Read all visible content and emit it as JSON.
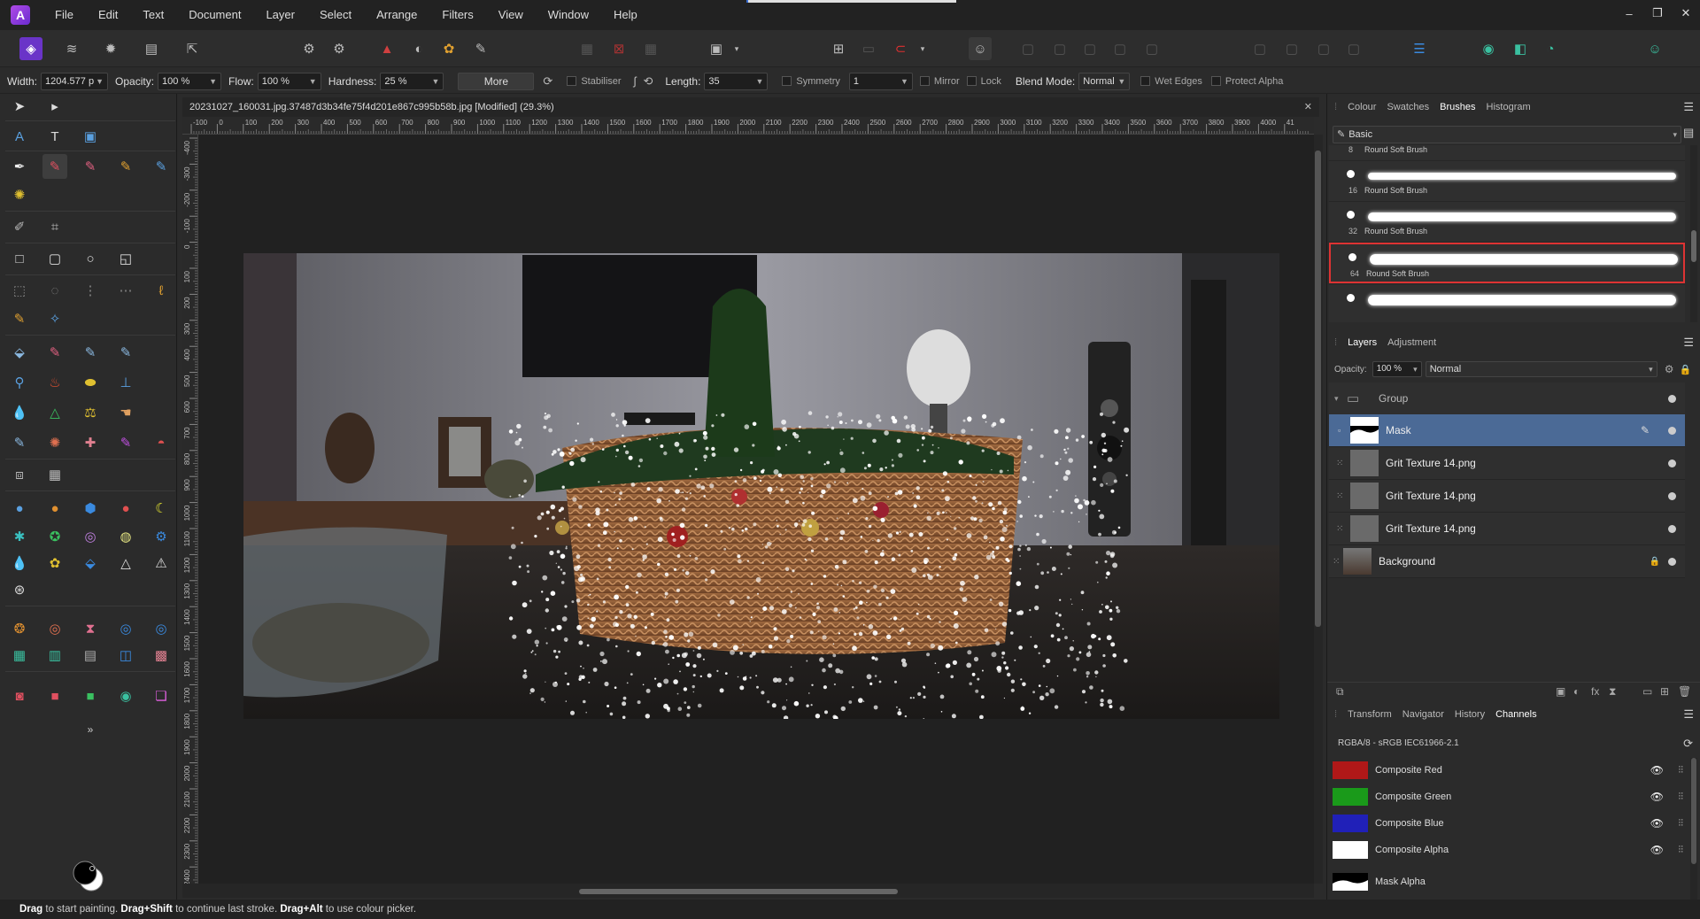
{
  "app": {
    "logo": "A"
  },
  "menu": [
    "File",
    "Edit",
    "Text",
    "Document",
    "Layer",
    "Select",
    "Arrange",
    "Filters",
    "View",
    "Window",
    "Help"
  ],
  "window_controls": [
    "–",
    "❐",
    "✕"
  ],
  "context_bar": {
    "width_label": "Width:",
    "width_value": "1204.577 p",
    "opacity_label": "Opacity:",
    "opacity_value": "100 %",
    "flow_label": "Flow:",
    "flow_value": "100 %",
    "hardness_label": "Hardness:",
    "hardness_value": "25 %",
    "more_label": "More",
    "stabiliser_label": "Stabiliser",
    "length_label": "Length:",
    "length_value": "35",
    "symmetry_label": "Symmetry",
    "symmetry_value": "1",
    "mirror_label": "Mirror",
    "lock_label": "Lock",
    "blend_label": "Blend Mode:",
    "blend_value": "Normal",
    "wet_edges_label": "Wet Edges",
    "protect_alpha_label": "Protect Alpha"
  },
  "document": {
    "title": "20231027_160031.jpg.37487d3b34fe75f4d201e867c995b58b.jpg [Modified] (29.3%)"
  },
  "ruler_h": [
    "-100",
    "0",
    "100",
    "200",
    "300",
    "400",
    "500",
    "600",
    "700",
    "800",
    "900",
    "1000",
    "1100",
    "1200",
    "1300",
    "1400",
    "1500",
    "1600",
    "1700",
    "1800",
    "1900",
    "2000",
    "2100",
    "2200",
    "2300",
    "2400",
    "2500",
    "2600",
    "2700",
    "2800",
    "2900",
    "3000",
    "3100",
    "3200",
    "3300",
    "3400",
    "3500",
    "3600",
    "3700",
    "3800",
    "3900",
    "4000",
    "41"
  ],
  "ruler_v": [
    "-400",
    "-300",
    "-200",
    "-100",
    "0",
    "100",
    "200",
    "300",
    "400",
    "500",
    "600",
    "700",
    "800",
    "900",
    "1000",
    "1100",
    "1200",
    "1300",
    "1400",
    "1500",
    "1600",
    "1700",
    "1800",
    "1900",
    "2000",
    "2100",
    "2200",
    "2300",
    "2400"
  ],
  "status": {
    "drag": "Drag",
    "t1": " to start painting. ",
    "drag_shift": "Drag+Shift",
    "t2": " to continue last stroke. ",
    "drag_alt": "Drag+Alt",
    "t3": " to use colour picker."
  },
  "brushes_panel": {
    "tabs": [
      "Colour",
      "Swatches",
      "Brushes",
      "Histogram"
    ],
    "active_tab": "Brushes",
    "category": "Basic",
    "brushes": [
      {
        "size": "8",
        "name": "Round Soft Brush"
      },
      {
        "size": "16",
        "name": "Round Soft Brush"
      },
      {
        "size": "32",
        "name": "Round Soft Brush"
      },
      {
        "size": "64",
        "name": "Round Soft Brush"
      },
      {
        "size": "",
        "name": ""
      }
    ],
    "selected_index": 3
  },
  "layers_panel": {
    "tabs": [
      "Layers",
      "Adjustment"
    ],
    "opacity_label": "Opacity:",
    "opacity_value": "100 %",
    "blend_value": "Normal",
    "layers": [
      {
        "name": "Group"
      },
      {
        "name": "Mask"
      },
      {
        "name": "Grit Texture 14.png"
      },
      {
        "name": "Grit Texture 14.png"
      },
      {
        "name": "Grit Texture 14.png"
      },
      {
        "name": "Background"
      }
    ],
    "selected": "Mask"
  },
  "channels_panel": {
    "tabs": [
      "Transform",
      "Navigator",
      "History",
      "Channels"
    ],
    "active_tab": "Channels",
    "profile": "RGBA/8 - sRGB IEC61966-2.1",
    "channels": [
      {
        "name": "Composite Red",
        "color": "#b01818"
      },
      {
        "name": "Composite Green",
        "color": "#1a9a1a"
      },
      {
        "name": "Composite Blue",
        "color": "#2020b8"
      },
      {
        "name": "Composite Alpha",
        "color": "#ffffff"
      },
      {
        "name": "Mask Alpha",
        "color": "#ffffff"
      }
    ]
  },
  "colors": {
    "accent": "#4b6a96",
    "selection_border": "#dd3333",
    "brand": "#8a3ee0"
  }
}
